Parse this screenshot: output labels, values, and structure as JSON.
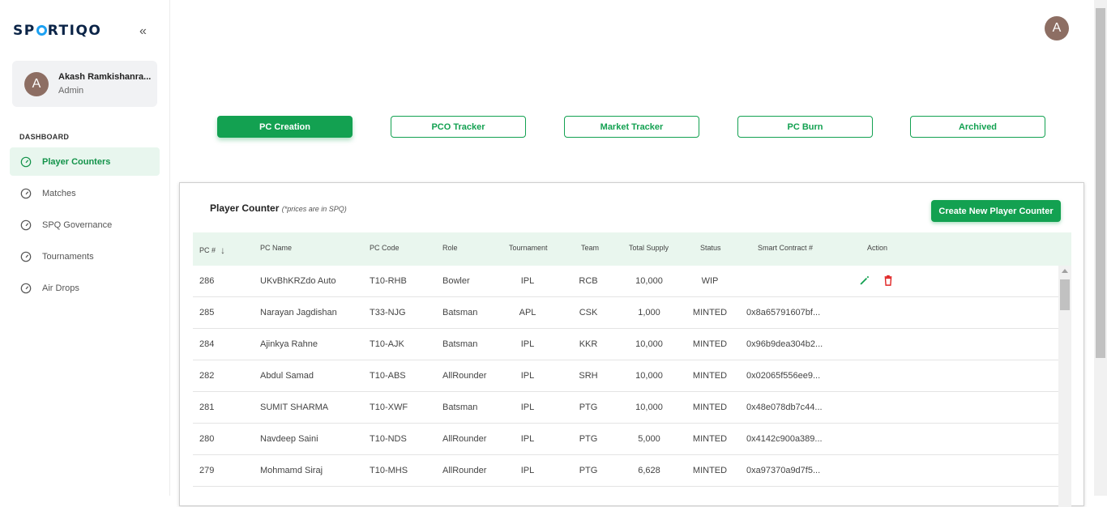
{
  "brand": {
    "logo_text_pre": "SP",
    "logo_text_post": "RTIQO"
  },
  "user": {
    "name": "Akash Ramkishanra...",
    "role": "Admin",
    "initial": "A"
  },
  "nav": {
    "heading": "DASHBOARD",
    "items": [
      {
        "label": "Player Counters",
        "icon": "gauge-icon",
        "active": true
      },
      {
        "label": "Matches",
        "icon": "gauge-icon",
        "active": false
      },
      {
        "label": "SPQ Governance",
        "icon": "gauge-icon",
        "active": false
      },
      {
        "label": "Tournaments",
        "icon": "gauge-icon",
        "active": false
      },
      {
        "label": "Air Drops",
        "icon": "gauge-icon",
        "active": false
      }
    ]
  },
  "top_avatar": {
    "initial": "A"
  },
  "tabs": [
    {
      "label": "PC Creation",
      "active": true
    },
    {
      "label": "PCO Tracker",
      "active": false
    },
    {
      "label": "Market Tracker",
      "active": false
    },
    {
      "label": "PC Burn",
      "active": false
    },
    {
      "label": "Archived",
      "active": false
    }
  ],
  "card": {
    "title": "Player Counter",
    "note": "(*prices are in SPQ)",
    "create_button": "Create New Player Counter"
  },
  "table": {
    "columns": [
      "PC #",
      "PC Name",
      "PC Code",
      "Role",
      "Tournament",
      "Team",
      "Total Supply",
      "Status",
      "Smart Contract #",
      "Action"
    ],
    "rows": [
      {
        "pc": "286",
        "name": "UKvBhKRZdo Auto",
        "code": "T10-RHB",
        "role": "Bowler",
        "tournament": "IPL",
        "team": "RCB",
        "supply": "10,000",
        "status": "WIP",
        "contract": "",
        "actions": true
      },
      {
        "pc": "285",
        "name": "Narayan Jagdishan",
        "code": "T33-NJG",
        "role": "Batsman",
        "tournament": "APL",
        "team": "CSK",
        "supply": "1,000",
        "status": "MINTED",
        "contract": "0x8a65791607bf...",
        "actions": false
      },
      {
        "pc": "284",
        "name": "Ajinkya Rahne",
        "code": "T10-AJK",
        "role": "Batsman",
        "tournament": "IPL",
        "team": "KKR",
        "supply": "10,000",
        "status": "MINTED",
        "contract": "0x96b9dea304b2...",
        "actions": false
      },
      {
        "pc": "282",
        "name": "Abdul Samad",
        "code": "T10-ABS",
        "role": "AllRounder",
        "tournament": "IPL",
        "team": "SRH",
        "supply": "10,000",
        "status": "MINTED",
        "contract": "0x02065f556ee9...",
        "actions": false
      },
      {
        "pc": "281",
        "name": "SUMIT SHARMA",
        "code": "T10-XWF",
        "role": "Batsman",
        "tournament": "IPL",
        "team": "PTG",
        "supply": "10,000",
        "status": "MINTED",
        "contract": "0x48e078db7c44...",
        "actions": false
      },
      {
        "pc": "280",
        "name": "Navdeep Saini",
        "code": "T10-NDS",
        "role": "AllRounder",
        "tournament": "IPL",
        "team": "PTG",
        "supply": "5,000",
        "status": "MINTED",
        "contract": "0x4142c900a389...",
        "actions": false
      },
      {
        "pc": "279",
        "name": "Mohmamd Siraj",
        "code": "T10-MHS",
        "role": "AllRounder",
        "tournament": "IPL",
        "team": "PTG",
        "supply": "6,628",
        "status": "MINTED",
        "contract": "0xa97370a9d7f5...",
        "actions": false
      }
    ]
  },
  "colors": {
    "accent": "#13a151",
    "brand_navy": "#0b2447",
    "brand_blue": "#1da1f2",
    "delete": "#e02424",
    "avatar": "#8d6e63"
  }
}
